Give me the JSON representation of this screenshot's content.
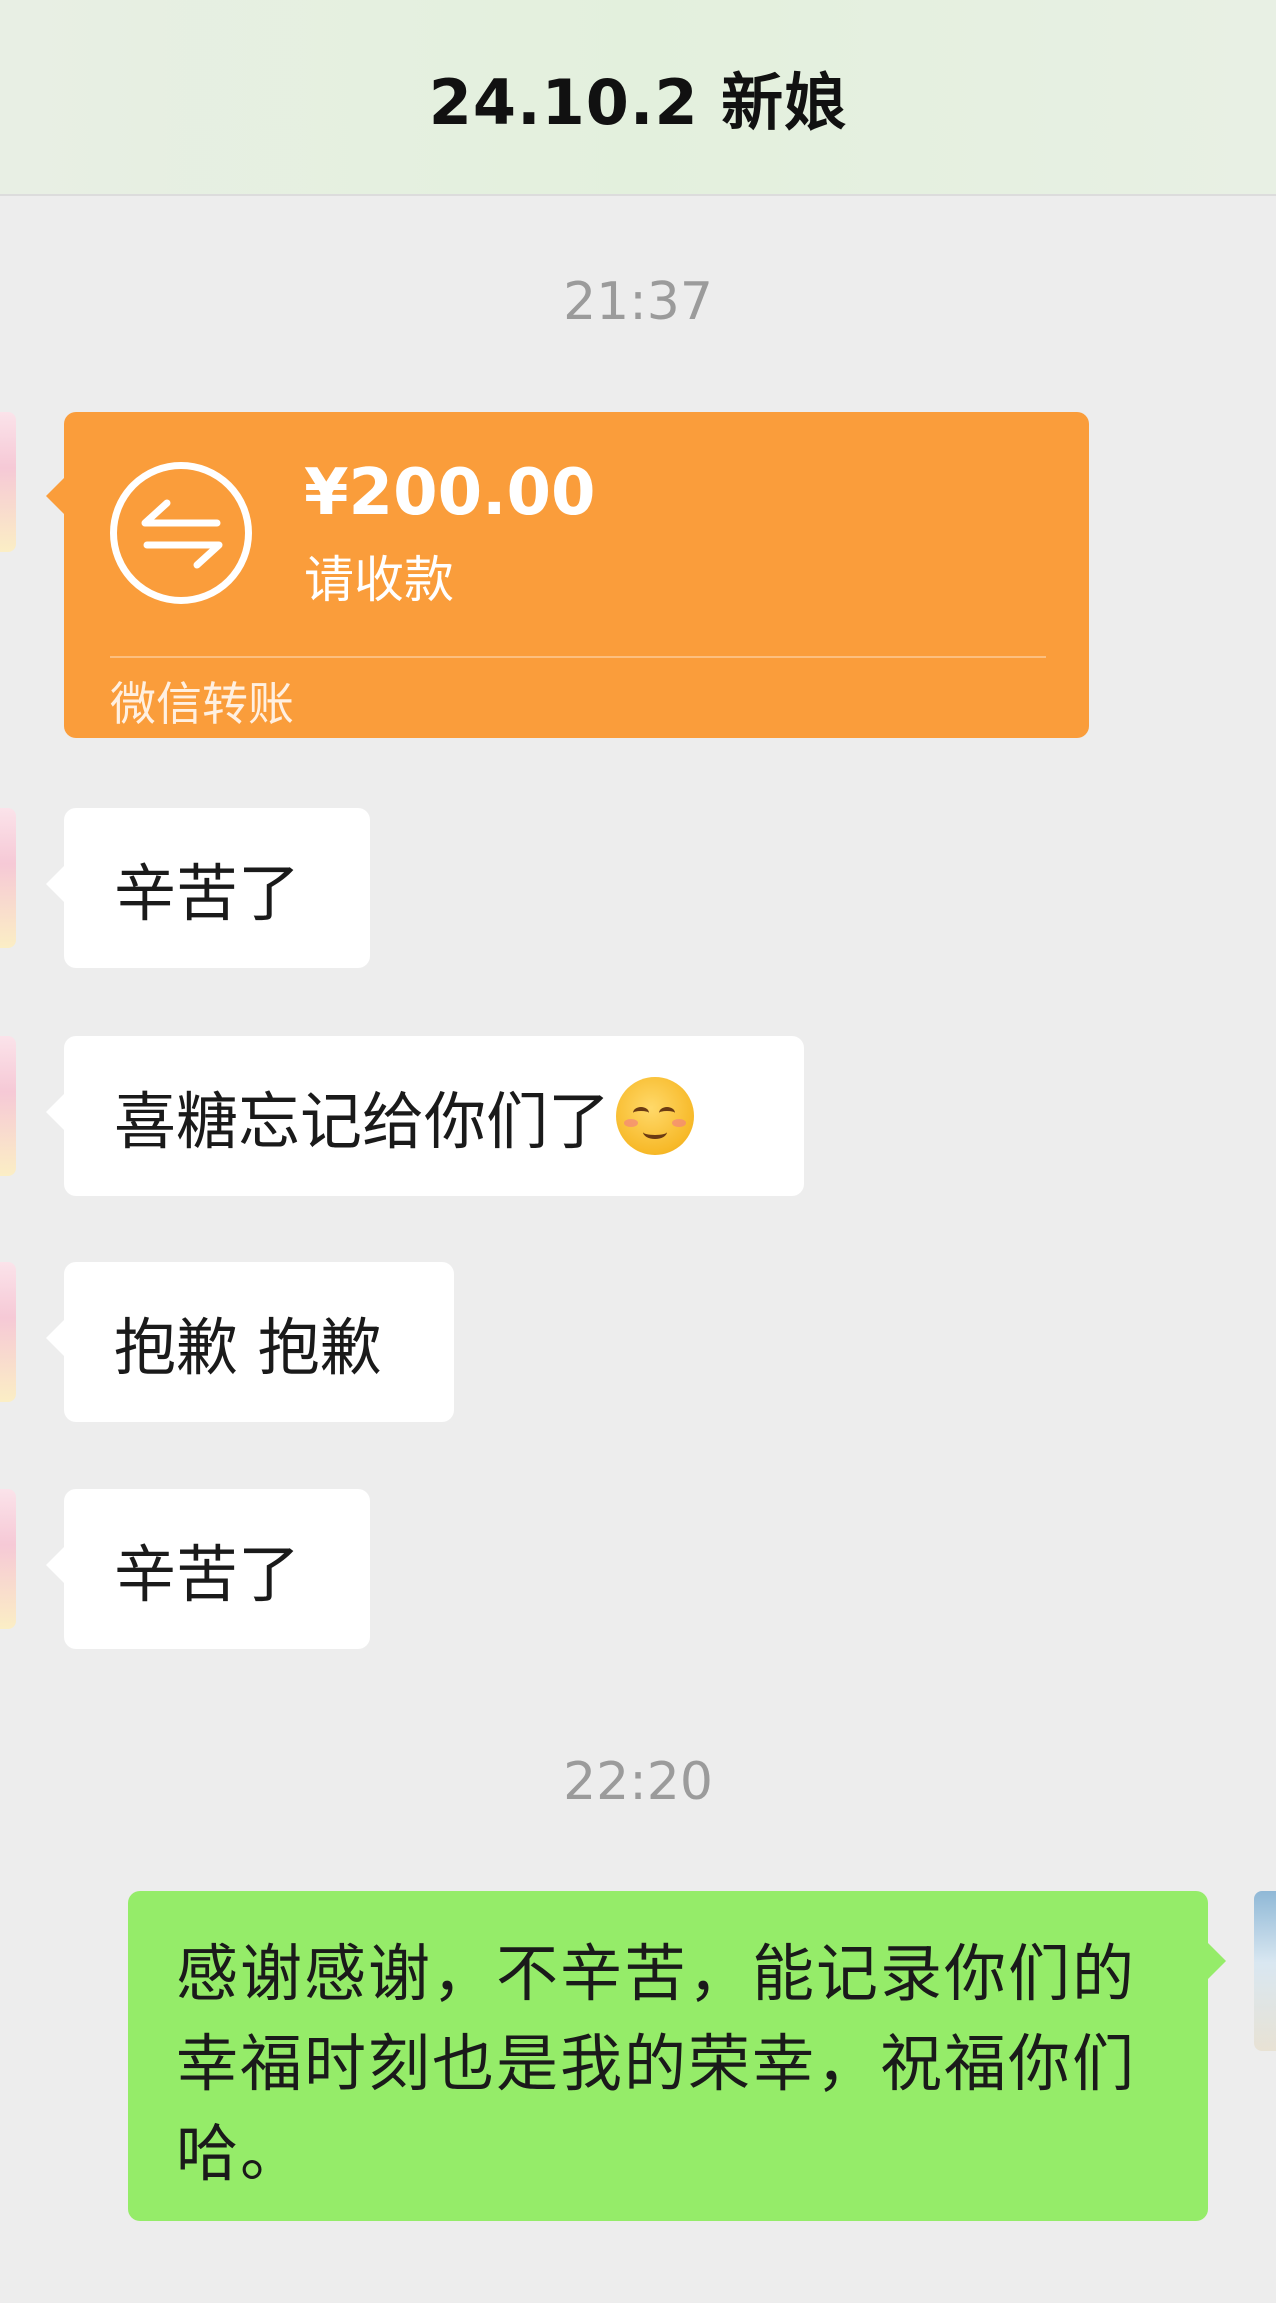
{
  "header": {
    "title": "24.10.2 新娘"
  },
  "timestamps": [
    "21:37",
    "22:20"
  ],
  "transfer": {
    "amount": "¥200.00",
    "status": "请收款",
    "footer": "微信转账",
    "icon": "transfer-arrows-icon",
    "color": "#fa9d3b"
  },
  "messages_left": [
    {
      "text": "辛苦了"
    },
    {
      "text": "喜糖忘记给你们了",
      "emoji": "relieved-face-emoji"
    },
    {
      "text": "抱歉 抱歉"
    },
    {
      "text": "辛苦了"
    }
  ],
  "message_right": {
    "text": "感谢感谢，不辛苦，能记录你们的幸福时刻也是我的荣幸，祝福你们哈。",
    "color": "#95ec69"
  }
}
